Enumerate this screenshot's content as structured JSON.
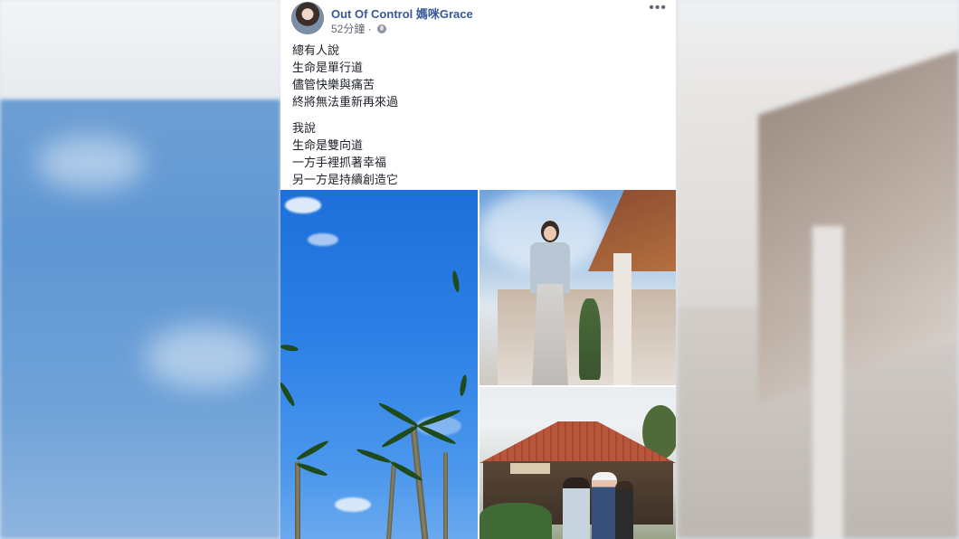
{
  "post": {
    "author": "Out Of Control 媽咪Grace",
    "time": "52分鐘",
    "separator": "·",
    "paragraphs": [
      [
        "總有人說",
        "生命是單行道",
        "儘管快樂與痛苦",
        "終將無法重新再來過"
      ],
      [
        "我說",
        "生命是雙向道",
        "一方手裡抓著幸福",
        "另一方是持續創造它"
      ]
    ],
    "photos": [
      {
        "name": "blue-sky-palm-trees"
      },
      {
        "name": "woman-denim-jacket-building"
      },
      {
        "name": "family-in-front-of-red-roof-shop"
      }
    ],
    "icons": {
      "privacy": "globe-icon",
      "menu": "more-options-icon"
    }
  },
  "colors": {
    "author_link": "#385898",
    "meta": "#606770",
    "text": "#1d2129"
  }
}
